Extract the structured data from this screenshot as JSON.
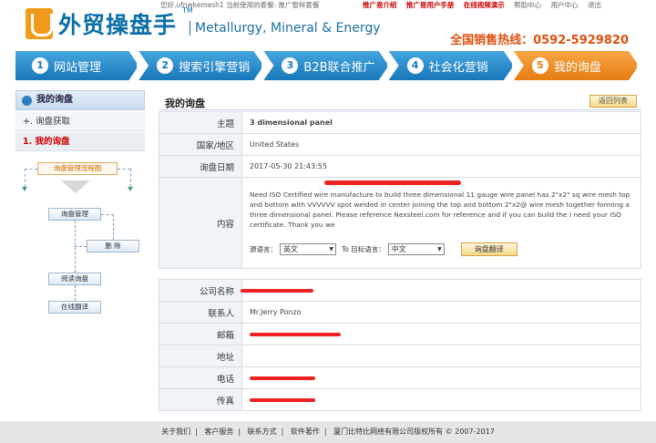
{
  "topbar": {
    "greeting": "您好,ufnwkemesh1 当前使用的套餐: 推广智样套餐",
    "links": [
      {
        "label": "推广易介绍",
        "red": true
      },
      {
        "label": "推广易用户手册",
        "red": true
      },
      {
        "label": "在线视频演示",
        "red": true
      },
      {
        "label": "帮助中心",
        "red": false
      },
      {
        "label": "用户中心",
        "red": false
      },
      {
        "label": "退出",
        "red": false
      }
    ]
  },
  "header": {
    "logo_cn": "外贸操盘手",
    "logo_tm": "TM",
    "logo_en": "Metallurgy, Mineral & Energy",
    "hotline": "全国销售热线：0592-5929820"
  },
  "steps": [
    {
      "num": "1",
      "label": "网站管理"
    },
    {
      "num": "2",
      "label": "搜索引擎营销"
    },
    {
      "num": "3",
      "label": "B2B联合推广"
    },
    {
      "num": "4",
      "label": "社会化营销"
    },
    {
      "num": "5",
      "label": "我的询盘",
      "active": true
    }
  ],
  "sidebar": {
    "title": "我的询盘",
    "items": [
      "+. 询盘获取",
      "1. 我的询盘"
    ]
  },
  "flow": {
    "title": "询盘管理流程图",
    "manage": "询盘管理",
    "delete": "删 除",
    "read": "阅读询盘",
    "translate": "在线翻译"
  },
  "main": {
    "title": "我的询盘",
    "back_label": "返回列表",
    "rows": {
      "subject_label": "主题",
      "subject": "3 dimensional panel",
      "country_label": "国家/地区",
      "country": "United States",
      "date_label": "询盘日期",
      "date": "2017-05-30 21:43:55",
      "content_label": "内容",
      "content": "Need ISO Certified wire manufacture to build three dimensional 11 gauge wire panel has 2\"x2\" sq wire mesh top and bottom with VVVVVV spot welded in center joining the top and bottom 2\"x2@ wire mesh together forming a three dimensional panel. Please reference Nexsteel.com for reference and if you can build the I need your ISO certificate. Thank you we"
    },
    "translate": {
      "src_label": "源语言：",
      "src_value": "英文",
      "to_label": "To 目标语言：",
      "dst_value": "中文",
      "button": "询盘翻译"
    },
    "contact": {
      "company_label": "公司名称",
      "person_label": "联系人",
      "person": "Mr.Jerry Ponzo",
      "email_label": "邮箱",
      "address_label": "地址",
      "phone_label": "电话",
      "fax_label": "传真"
    }
  },
  "footer": {
    "links": [
      "关于我们",
      "客户服务",
      "联系方式",
      "软件著作"
    ],
    "copyright": "厦门比特比网络有限公司版权所有 © 2007-2017"
  },
  "colors": {
    "step_blue": "#1877b9",
    "step_orange": "#e57d12",
    "redact": "#ee2222"
  }
}
